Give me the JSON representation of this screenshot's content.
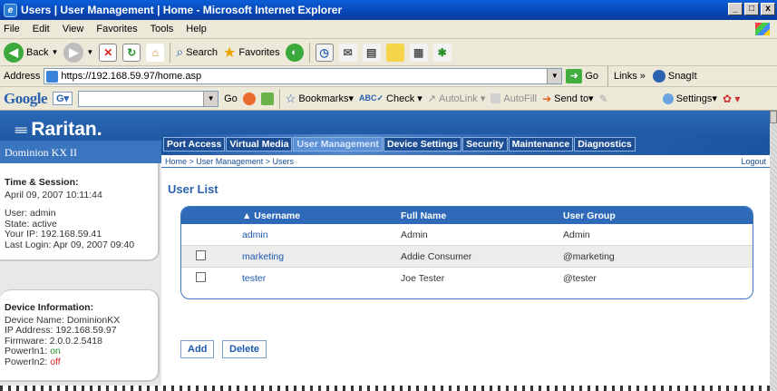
{
  "window": {
    "title": "Users | User Management | Home - Microsoft Internet Explorer",
    "controls": [
      "_",
      "□",
      "x"
    ]
  },
  "menu": [
    "File",
    "Edit",
    "View",
    "Favorites",
    "Tools",
    "Help"
  ],
  "toolbar": {
    "back_label": "Back",
    "search_label": "Search",
    "favorites_label": "Favorites"
  },
  "address": {
    "label": "Address",
    "url": "https://192.168.59.97/home.asp",
    "go_label": "Go",
    "links_label": "Links »",
    "snagit_label": "SnagIt"
  },
  "googlebar": {
    "logo": "Google",
    "search_letter": "G▾",
    "go_label": "Go",
    "bookmarks_label": "Bookmarks▾",
    "check_label": "Check ▾",
    "autolink_label": "AutoLink ▾",
    "autofill_label": "AutoFill",
    "sendto_label": "Send to▾",
    "settings_label": "Settings▾"
  },
  "brand": {
    "logo": "Raritan.",
    "logo_mark": "≡≡",
    "product": "Dominion KX II"
  },
  "session": {
    "heading": "Time & Session:",
    "datetime": "April 09, 2007 10:11:44",
    "user": "User: admin",
    "state": "State: active",
    "ip": "Your IP: 192.168.59.41",
    "last_login": "Last Login: Apr 09, 2007 09:40"
  },
  "device": {
    "heading": "Device Information:",
    "name": "Device Name: DominionKX",
    "ip": "IP Address: 192.168.59.97",
    "firmware": "Firmware: 2.0.0.2.5418",
    "power1_label": "PowerIn1: ",
    "power1_value": "on",
    "power2_label": "PowerIn2: ",
    "power2_value": "off"
  },
  "tabs": [
    "Port Access",
    "Virtual Media",
    "User Management",
    "Device Settings",
    "Security",
    "Maintenance",
    "Diagnostics"
  ],
  "active_tab": "User Management",
  "breadcrumb": "Home > User Management > Users",
  "logout_label": "Logout",
  "page_title": "User List",
  "table": {
    "headers": [
      "▲ Username",
      "Full Name",
      "User Group"
    ],
    "rows": [
      {
        "username": "admin",
        "full_name": "Admin",
        "group": "Admin",
        "checkbox": false
      },
      {
        "username": "marketing",
        "full_name": "Addie Consumer",
        "group": "@marketing",
        "checkbox": true
      },
      {
        "username": "tester",
        "full_name": "Joe Tester",
        "group": "@tester",
        "checkbox": true
      }
    ]
  },
  "buttons": {
    "add": "Add",
    "delete": "Delete"
  },
  "colors": {
    "brand_blue": "#1a4c93",
    "header_blue": "#2e6ab8",
    "power_on": "#2a8f2a",
    "power_off": "#dd2222"
  }
}
